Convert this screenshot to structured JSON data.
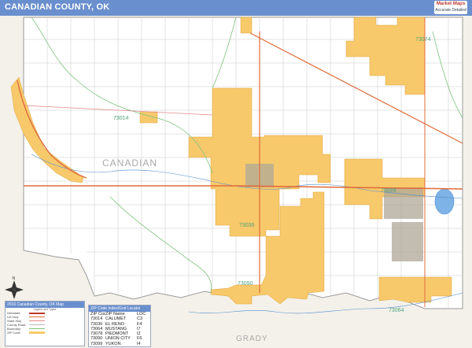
{
  "header": {
    "title": "CANADIAN COUNTY, OK",
    "logo_text": "Market Maps",
    "logo_sub": "Accurate Detailed"
  },
  "colors": {
    "header": "#6a8fce",
    "zip_area": "#f7c96b",
    "water": "#7db3e6",
    "green_line": "#7dc27d",
    "road_red": "#e06c3c",
    "grid": "#b8b8b8"
  },
  "map": {
    "county_label": "CANADIAN",
    "neighbor_label": "GRADY",
    "zip_labels": [
      "73014",
      "73099",
      "73036",
      "73064",
      "73090",
      "73074"
    ]
  },
  "legend": {
    "title": "2016 Canadian County, OK Map",
    "subtitle": "Legend and Types",
    "items": [
      "Interstate",
      "US Hwy",
      "State Hwy",
      "County Road",
      "Boundary",
      "ZIP Code"
    ]
  },
  "zip_index": {
    "title": "ZIP Code Index/Grid Locator",
    "columns": [
      "ZIP Code",
      "ZIP Name",
      "LOC"
    ],
    "rows": [
      [
        "73014",
        "CALUMET",
        "C3"
      ],
      [
        "73036",
        "EL RENO",
        "F4"
      ],
      [
        "73064",
        "MUSTANG",
        "I7"
      ],
      [
        "73078",
        "PIEDMONT",
        "I2"
      ],
      [
        "73090",
        "UNION CITY",
        "F6"
      ],
      [
        "73099",
        "YUKON",
        "I4"
      ]
    ]
  },
  "compass": {
    "north": "N"
  }
}
